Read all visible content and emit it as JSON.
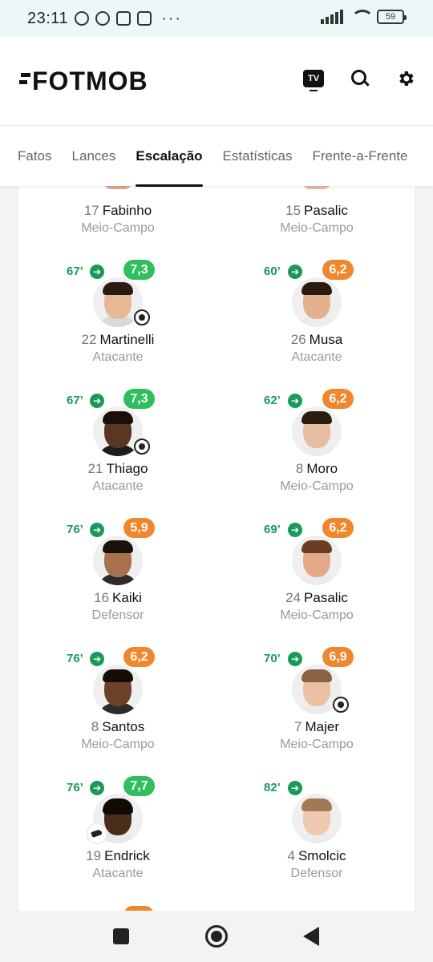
{
  "status_bar": {
    "time": "23:11",
    "dots": "···",
    "battery": "59"
  },
  "header": {
    "logo": "FOTMOB",
    "tv_label": "TV"
  },
  "tabs": [
    {
      "label": "Fatos",
      "active": false
    },
    {
      "label": "Lances",
      "active": false
    },
    {
      "label": "Escalação",
      "active": true
    },
    {
      "label": "Estatísticas",
      "active": false
    },
    {
      "label": "Frente-a-Frente",
      "active": false
    }
  ],
  "colors": {
    "rating_green": "#2fbf5c",
    "rating_orange": "#f0872c",
    "sub_green": "#1a9a58"
  },
  "left_players": [
    {
      "number": "17",
      "name": "Fabinho",
      "position": "Meio-Campo"
    },
    {
      "number": "22",
      "name": "Martinelli",
      "position": "Atacante",
      "sub_minute": "67’",
      "rating": "7,3",
      "rating_color": "green",
      "icon": "ball-icon"
    },
    {
      "number": "21",
      "name": "Thiago",
      "position": "Atacante",
      "sub_minute": "67’",
      "rating": "7,3",
      "rating_color": "green",
      "icon": "ball-icon"
    },
    {
      "number": "16",
      "name": "Kaiki",
      "position": "Defensor",
      "sub_minute": "76’",
      "rating": "5,9",
      "rating_color": "orange"
    },
    {
      "number": "8",
      "name": "Santos",
      "position": "Meio-Campo",
      "sub_minute": "76’",
      "rating": "6,2",
      "rating_color": "orange"
    },
    {
      "number": "19",
      "name": "Endrick",
      "position": "Atacante",
      "sub_minute": "76’",
      "rating": "7,7",
      "rating_color": "green",
      "icon": "boot-icon"
    }
  ],
  "right_players": [
    {
      "number": "15",
      "name": "Pasalic",
      "position": "Meio-Campo"
    },
    {
      "number": "26",
      "name": "Musa",
      "position": "Atacante",
      "sub_minute": "60’",
      "rating": "6,2",
      "rating_color": "orange"
    },
    {
      "number": "8",
      "name": "Moro",
      "position": "Meio-Campo",
      "sub_minute": "62’",
      "rating": "6,2",
      "rating_color": "orange"
    },
    {
      "number": "24",
      "name": "Pasalic",
      "position": "Meio-Campo",
      "sub_minute": "69’",
      "rating": "6,2",
      "rating_color": "orange"
    },
    {
      "number": "7",
      "name": "Majer",
      "position": "Meio-Campo",
      "sub_minute": "70’",
      "rating": "6,9",
      "rating_color": "orange",
      "icon": "ball-icon"
    },
    {
      "number": "4",
      "name": "Smolcic",
      "position": "Defensor",
      "sub_minute": "82’"
    }
  ]
}
